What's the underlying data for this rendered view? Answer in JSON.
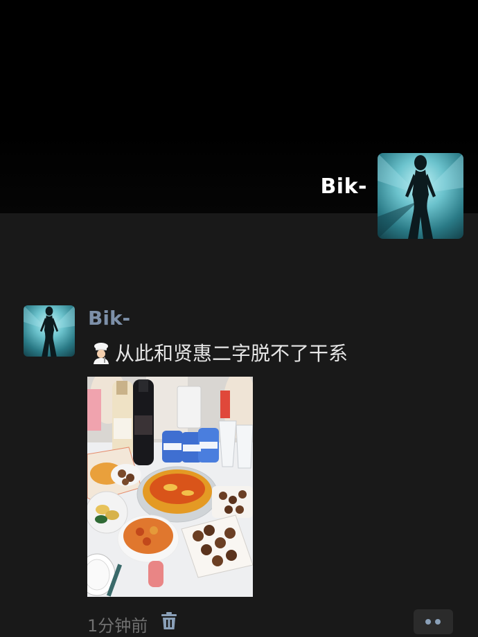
{
  "header": {
    "name": "Bik-",
    "avatar_icon": "profile-avatar"
  },
  "post": {
    "author": "Bik-",
    "avatar_icon": "profile-avatar",
    "emoji": "chef-emoji",
    "text": "从此和贤惠二字脱不了干系",
    "photo_icon": "food-table-photo",
    "time": "1分钟前",
    "delete_icon": "trash-icon",
    "more_icon": "more-dots-icon"
  },
  "colors": {
    "background": "#191919",
    "cover": "#000000",
    "name_link": "#7d90a9",
    "body_text": "#e6e6e6",
    "muted": "#707070",
    "dots": "#8aa0b8"
  }
}
